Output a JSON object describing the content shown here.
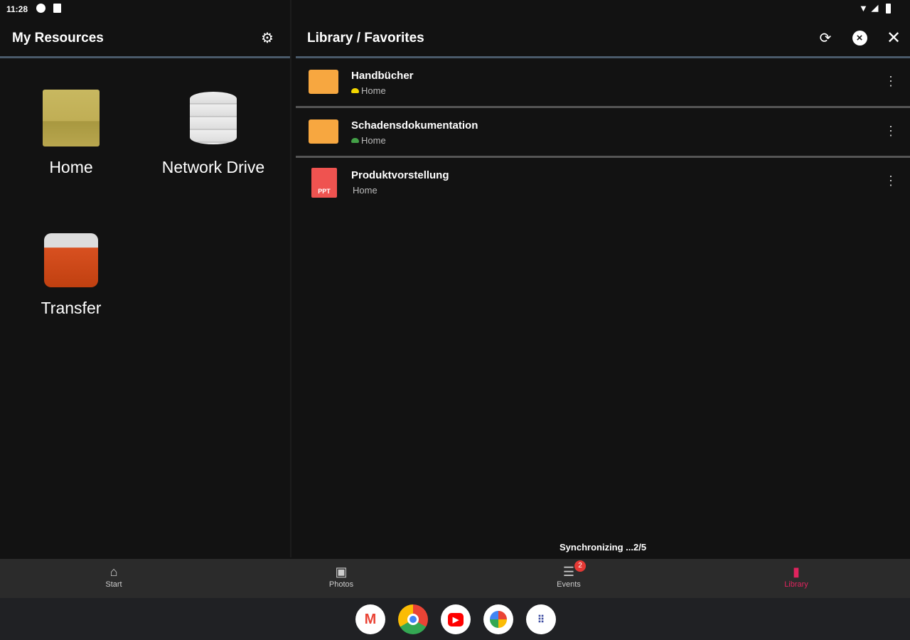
{
  "status": {
    "time": "11:28"
  },
  "left": {
    "title": "My Resources",
    "resources": [
      {
        "label": "Home"
      },
      {
        "label": "Network Drive"
      },
      {
        "label": "Transfer"
      }
    ]
  },
  "right": {
    "title": "Library / Favorites",
    "items": [
      {
        "name": "Handbücher",
        "location": "Home",
        "type": "folder",
        "cloud_color": "#f2d600"
      },
      {
        "name": "Schadensdokumentation",
        "location": "Home",
        "type": "folder",
        "cloud_color": "#43a047"
      },
      {
        "name": "Produktvorstellung",
        "location": "Home",
        "type": "ppt",
        "file_badge": "PPT"
      }
    ],
    "sync_status": "Synchronizing ...2/5"
  },
  "nav": {
    "tabs": [
      {
        "label": "Start"
      },
      {
        "label": "Photos"
      },
      {
        "label": "Events",
        "badge": "2"
      },
      {
        "label": "Library",
        "active": true
      }
    ],
    "active_color": "#e0245e"
  },
  "dock": {
    "apps": [
      "Gmail",
      "Chrome",
      "YouTube",
      "Photos",
      "App drawer"
    ]
  }
}
